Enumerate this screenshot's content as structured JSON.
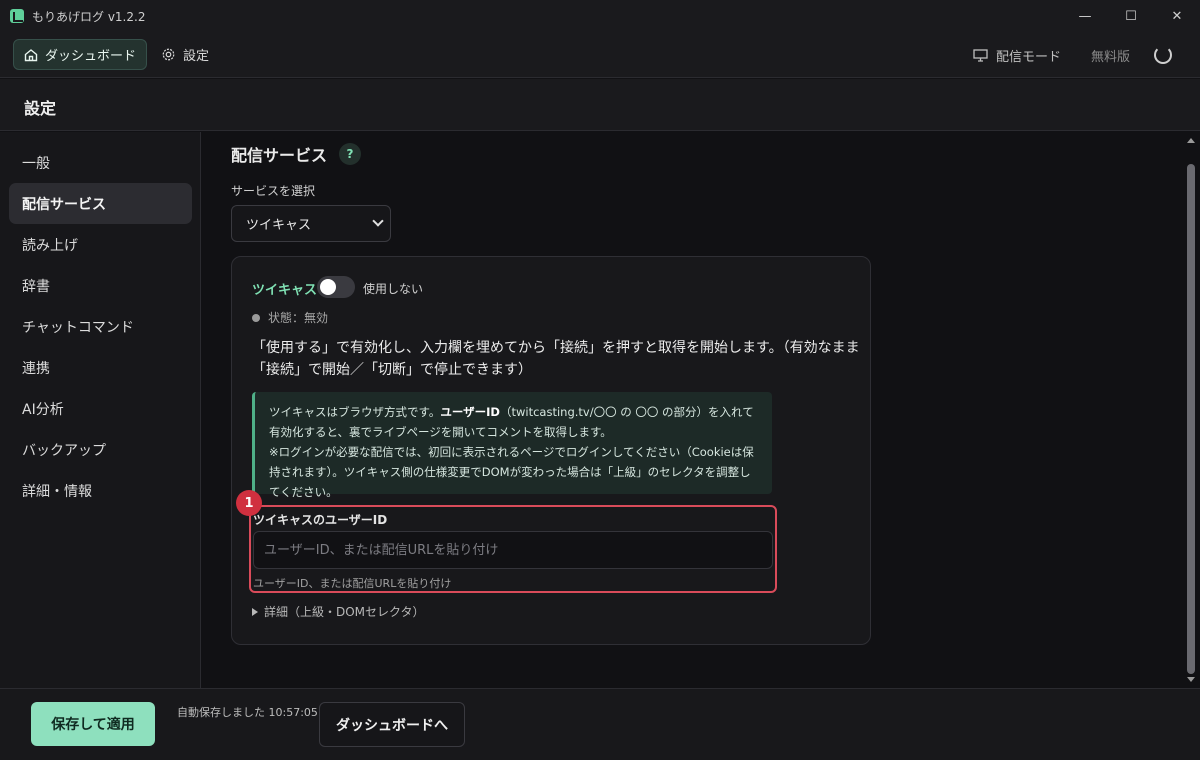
{
  "window": {
    "title": "もりあげログ v1.2.2",
    "controls": {
      "minimize": "—",
      "maximize": "☐",
      "close": "✕"
    }
  },
  "topnav": {
    "dashboard": "ダッシュボード",
    "settings": "設定",
    "stream_mode": "配信モード",
    "plan": "無料版"
  },
  "page": {
    "title": "設定"
  },
  "sidebar": {
    "items": [
      {
        "label": "一般"
      },
      {
        "label": "配信サービス"
      },
      {
        "label": "読み上げ"
      },
      {
        "label": "辞書"
      },
      {
        "label": "チャットコマンド"
      },
      {
        "label": "連携"
      },
      {
        "label": "AI分析"
      },
      {
        "label": "バックアップ"
      },
      {
        "label": "詳細・情報"
      }
    ],
    "active_index": 1
  },
  "main": {
    "section_title": "配信サービス",
    "help_icon": "?",
    "select_label": "サービスを選択",
    "select_value": "ツイキャス",
    "card": {
      "service_name": "ツイキャス",
      "toggle_on": false,
      "toggle_label": "使用しない",
      "status": "状態：無効",
      "description": "「使用する」で有効化し、入力欄を埋めてから「接続」を押すと取得を開始します。（有効なまま「接続」で開始／「切断」で停止できます）",
      "info": {
        "line1_pre": "ツイキャスはブラウザ方式です。",
        "line1_bold": "ユーザーID",
        "line1_post": "（twitcasting.tv/〇〇 の 〇〇 の部分）を入れて有効化すると、裏でライブページを開いてコメントを取得します。",
        "line2": "※ログインが必要な配信では、初回に表示されるページでログインしてください（Cookieは保持されます）。ツイキャス側の仕様変更でDOMが変わった場合は「上級」のセレクタを調整してください。"
      },
      "marker": "1",
      "field_label": "ツイキャスのユーザーID",
      "field_placeholder": "ユーザーID、または配信URLを貼り付け",
      "field_value": "",
      "field_hint": "ユーザーID、または配信URLを貼り付け",
      "details_label": "詳細（上級・DOMセレクタ）"
    }
  },
  "footer": {
    "save_label": "保存して適用",
    "autosave": "自動保存しました 10:57:05",
    "dashboard_label": "ダッシュボードへ"
  },
  "colors": {
    "accent": "#7fe0b3",
    "primary_button": "#8ee0be",
    "highlight_border": "#d94b5a",
    "marker": "#d0303f"
  }
}
